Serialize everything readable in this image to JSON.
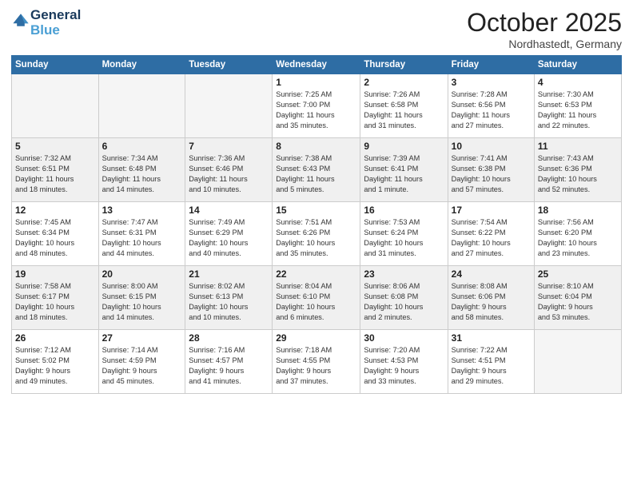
{
  "header": {
    "logo_line1": "General",
    "logo_line2": "Blue",
    "month": "October 2025",
    "location": "Nordhastedt, Germany"
  },
  "weekdays": [
    "Sunday",
    "Monday",
    "Tuesday",
    "Wednesday",
    "Thursday",
    "Friday",
    "Saturday"
  ],
  "weeks": [
    [
      {
        "day": "",
        "info": ""
      },
      {
        "day": "",
        "info": ""
      },
      {
        "day": "",
        "info": ""
      },
      {
        "day": "1",
        "info": "Sunrise: 7:25 AM\nSunset: 7:00 PM\nDaylight: 11 hours\nand 35 minutes."
      },
      {
        "day": "2",
        "info": "Sunrise: 7:26 AM\nSunset: 6:58 PM\nDaylight: 11 hours\nand 31 minutes."
      },
      {
        "day": "3",
        "info": "Sunrise: 7:28 AM\nSunset: 6:56 PM\nDaylight: 11 hours\nand 27 minutes."
      },
      {
        "day": "4",
        "info": "Sunrise: 7:30 AM\nSunset: 6:53 PM\nDaylight: 11 hours\nand 22 minutes."
      }
    ],
    [
      {
        "day": "5",
        "info": "Sunrise: 7:32 AM\nSunset: 6:51 PM\nDaylight: 11 hours\nand 18 minutes."
      },
      {
        "day": "6",
        "info": "Sunrise: 7:34 AM\nSunset: 6:48 PM\nDaylight: 11 hours\nand 14 minutes."
      },
      {
        "day": "7",
        "info": "Sunrise: 7:36 AM\nSunset: 6:46 PM\nDaylight: 11 hours\nand 10 minutes."
      },
      {
        "day": "8",
        "info": "Sunrise: 7:38 AM\nSunset: 6:43 PM\nDaylight: 11 hours\nand 5 minutes."
      },
      {
        "day": "9",
        "info": "Sunrise: 7:39 AM\nSunset: 6:41 PM\nDaylight: 11 hours\nand 1 minute."
      },
      {
        "day": "10",
        "info": "Sunrise: 7:41 AM\nSunset: 6:38 PM\nDaylight: 10 hours\nand 57 minutes."
      },
      {
        "day": "11",
        "info": "Sunrise: 7:43 AM\nSunset: 6:36 PM\nDaylight: 10 hours\nand 52 minutes."
      }
    ],
    [
      {
        "day": "12",
        "info": "Sunrise: 7:45 AM\nSunset: 6:34 PM\nDaylight: 10 hours\nand 48 minutes."
      },
      {
        "day": "13",
        "info": "Sunrise: 7:47 AM\nSunset: 6:31 PM\nDaylight: 10 hours\nand 44 minutes."
      },
      {
        "day": "14",
        "info": "Sunrise: 7:49 AM\nSunset: 6:29 PM\nDaylight: 10 hours\nand 40 minutes."
      },
      {
        "day": "15",
        "info": "Sunrise: 7:51 AM\nSunset: 6:26 PM\nDaylight: 10 hours\nand 35 minutes."
      },
      {
        "day": "16",
        "info": "Sunrise: 7:53 AM\nSunset: 6:24 PM\nDaylight: 10 hours\nand 31 minutes."
      },
      {
        "day": "17",
        "info": "Sunrise: 7:54 AM\nSunset: 6:22 PM\nDaylight: 10 hours\nand 27 minutes."
      },
      {
        "day": "18",
        "info": "Sunrise: 7:56 AM\nSunset: 6:20 PM\nDaylight: 10 hours\nand 23 minutes."
      }
    ],
    [
      {
        "day": "19",
        "info": "Sunrise: 7:58 AM\nSunset: 6:17 PM\nDaylight: 10 hours\nand 18 minutes."
      },
      {
        "day": "20",
        "info": "Sunrise: 8:00 AM\nSunset: 6:15 PM\nDaylight: 10 hours\nand 14 minutes."
      },
      {
        "day": "21",
        "info": "Sunrise: 8:02 AM\nSunset: 6:13 PM\nDaylight: 10 hours\nand 10 minutes."
      },
      {
        "day": "22",
        "info": "Sunrise: 8:04 AM\nSunset: 6:10 PM\nDaylight: 10 hours\nand 6 minutes."
      },
      {
        "day": "23",
        "info": "Sunrise: 8:06 AM\nSunset: 6:08 PM\nDaylight: 10 hours\nand 2 minutes."
      },
      {
        "day": "24",
        "info": "Sunrise: 8:08 AM\nSunset: 6:06 PM\nDaylight: 9 hours\nand 58 minutes."
      },
      {
        "day": "25",
        "info": "Sunrise: 8:10 AM\nSunset: 6:04 PM\nDaylight: 9 hours\nand 53 minutes."
      }
    ],
    [
      {
        "day": "26",
        "info": "Sunrise: 7:12 AM\nSunset: 5:02 PM\nDaylight: 9 hours\nand 49 minutes."
      },
      {
        "day": "27",
        "info": "Sunrise: 7:14 AM\nSunset: 4:59 PM\nDaylight: 9 hours\nand 45 minutes."
      },
      {
        "day": "28",
        "info": "Sunrise: 7:16 AM\nSunset: 4:57 PM\nDaylight: 9 hours\nand 41 minutes."
      },
      {
        "day": "29",
        "info": "Sunrise: 7:18 AM\nSunset: 4:55 PM\nDaylight: 9 hours\nand 37 minutes."
      },
      {
        "day": "30",
        "info": "Sunrise: 7:20 AM\nSunset: 4:53 PM\nDaylight: 9 hours\nand 33 minutes."
      },
      {
        "day": "31",
        "info": "Sunrise: 7:22 AM\nSunset: 4:51 PM\nDaylight: 9 hours\nand 29 minutes."
      },
      {
        "day": "",
        "info": ""
      }
    ]
  ]
}
